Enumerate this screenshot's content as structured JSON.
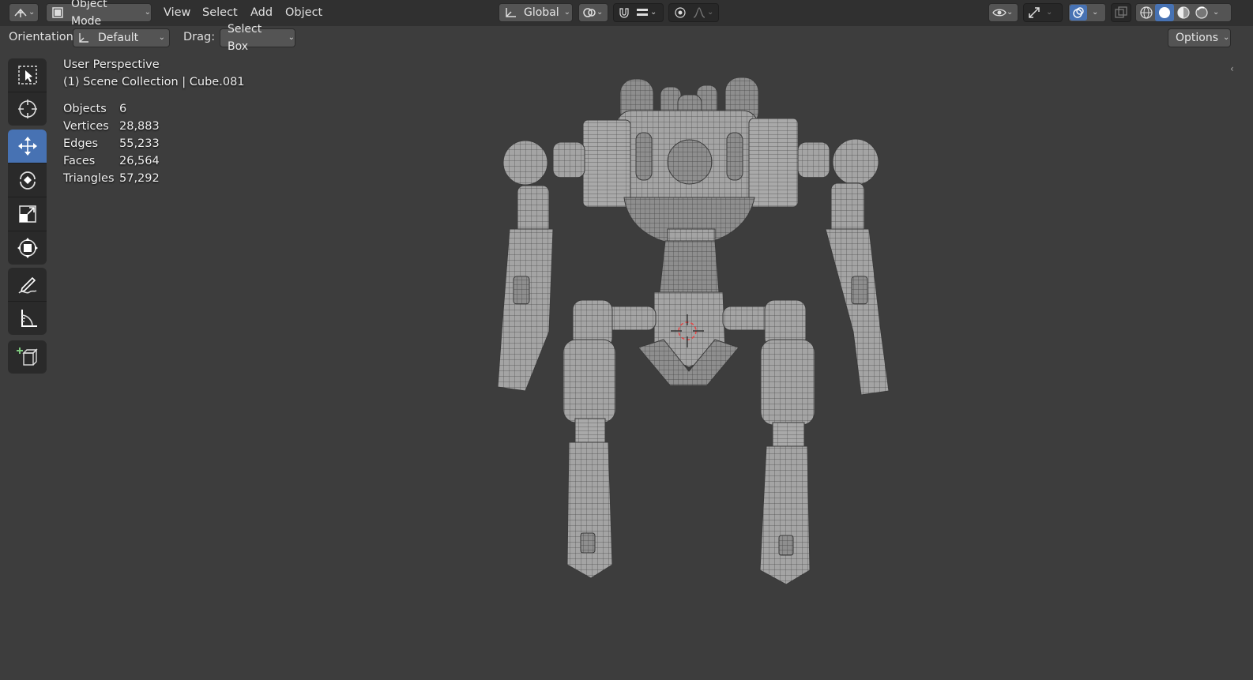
{
  "header": {
    "editor_type_icon": "3d-viewport-icon",
    "mode": "Object Mode",
    "menus": [
      "View",
      "Select",
      "Add",
      "Object"
    ],
    "transform_orientation": "Global"
  },
  "tool_header": {
    "orientation_label": "Orientation:",
    "orientation_value": "Default",
    "drag_label": "Drag:",
    "drag_value": "Select Box",
    "options_label": "Options"
  },
  "viewport": {
    "view_name": "User Perspective",
    "collection_path": "(1) Scene Collection | Cube.081",
    "stats": [
      {
        "label": "Objects",
        "value": "6"
      },
      {
        "label": "Vertices",
        "value": "28,883"
      },
      {
        "label": "Edges",
        "value": "55,233"
      },
      {
        "label": "Faces",
        "value": "26,564"
      },
      {
        "label": "Triangles",
        "value": "57,292"
      }
    ]
  },
  "toolbar": {
    "tools": [
      {
        "name": "select-box",
        "icon": "select-box-icon",
        "active": false
      },
      {
        "name": "cursor",
        "icon": "cursor-icon",
        "active": false
      },
      {
        "name": "move",
        "icon": "move-icon",
        "active": true
      },
      {
        "name": "rotate",
        "icon": "rotate-icon",
        "active": false
      },
      {
        "name": "scale",
        "icon": "scale-icon",
        "active": false
      },
      {
        "name": "transform",
        "icon": "transform-icon",
        "active": false
      },
      {
        "name": "annotate",
        "icon": "annotate-icon",
        "active": false
      },
      {
        "name": "measure",
        "icon": "measure-icon",
        "active": false
      },
      {
        "name": "add-cube",
        "icon": "add-cube-icon",
        "active": false
      }
    ]
  },
  "colors": {
    "accent": "#4772b3",
    "header_bg": "#303030",
    "viewport_bg": "#3d3d3d",
    "mesh_fill": "#9a9a9a",
    "mesh_wire": "#4a4a4a"
  }
}
